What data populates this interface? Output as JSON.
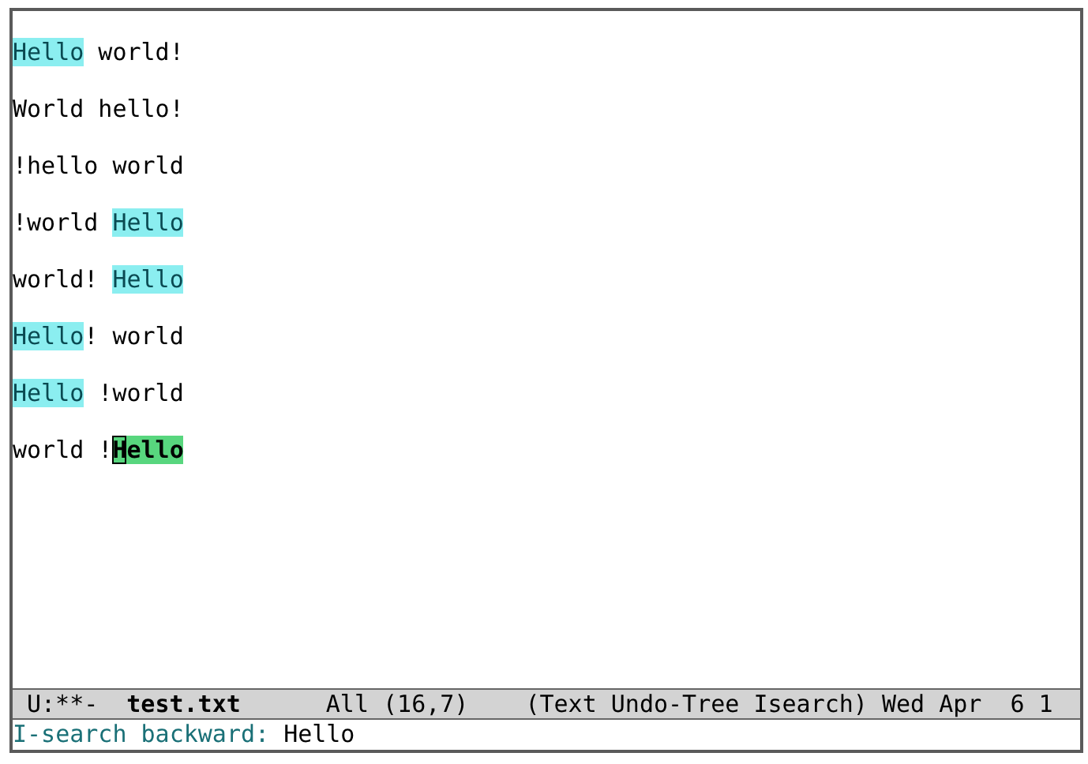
{
  "buffer": {
    "lines": [
      [
        {
          "text": "Hello",
          "kind": "match",
          "cursor": false
        },
        {
          "text": " world!",
          "kind": "plain",
          "cursor": false
        }
      ],
      [
        {
          "text": "World hello!",
          "kind": "plain",
          "cursor": false
        }
      ],
      [
        {
          "text": "!hello world",
          "kind": "plain",
          "cursor": false
        }
      ],
      [
        {
          "text": "!world ",
          "kind": "plain",
          "cursor": false
        },
        {
          "text": "Hello",
          "kind": "match",
          "cursor": false
        }
      ],
      [
        {
          "text": "world! ",
          "kind": "plain",
          "cursor": false
        },
        {
          "text": "Hello",
          "kind": "match",
          "cursor": false
        }
      ],
      [
        {
          "text": "Hello",
          "kind": "match",
          "cursor": false
        },
        {
          "text": "! world",
          "kind": "plain",
          "cursor": false
        }
      ],
      [
        {
          "text": "Hello",
          "kind": "match",
          "cursor": false
        },
        {
          "text": " !world",
          "kind": "plain",
          "cursor": false
        }
      ],
      [
        {
          "text": "world !",
          "kind": "plain",
          "cursor": false
        },
        {
          "text": "H",
          "kind": "current",
          "cursor": true
        },
        {
          "text": "ello",
          "kind": "current",
          "cursor": false
        }
      ]
    ]
  },
  "mode_line": {
    "status": "U:**-",
    "buffer_name": "test.txt",
    "position": "All (16,7)",
    "modes": "(Text Undo-Tree Isearch)",
    "clock": "Wed Apr  6 1"
  },
  "minibuffer": {
    "prompt": "I-search backward:",
    "value": "Hello"
  }
}
